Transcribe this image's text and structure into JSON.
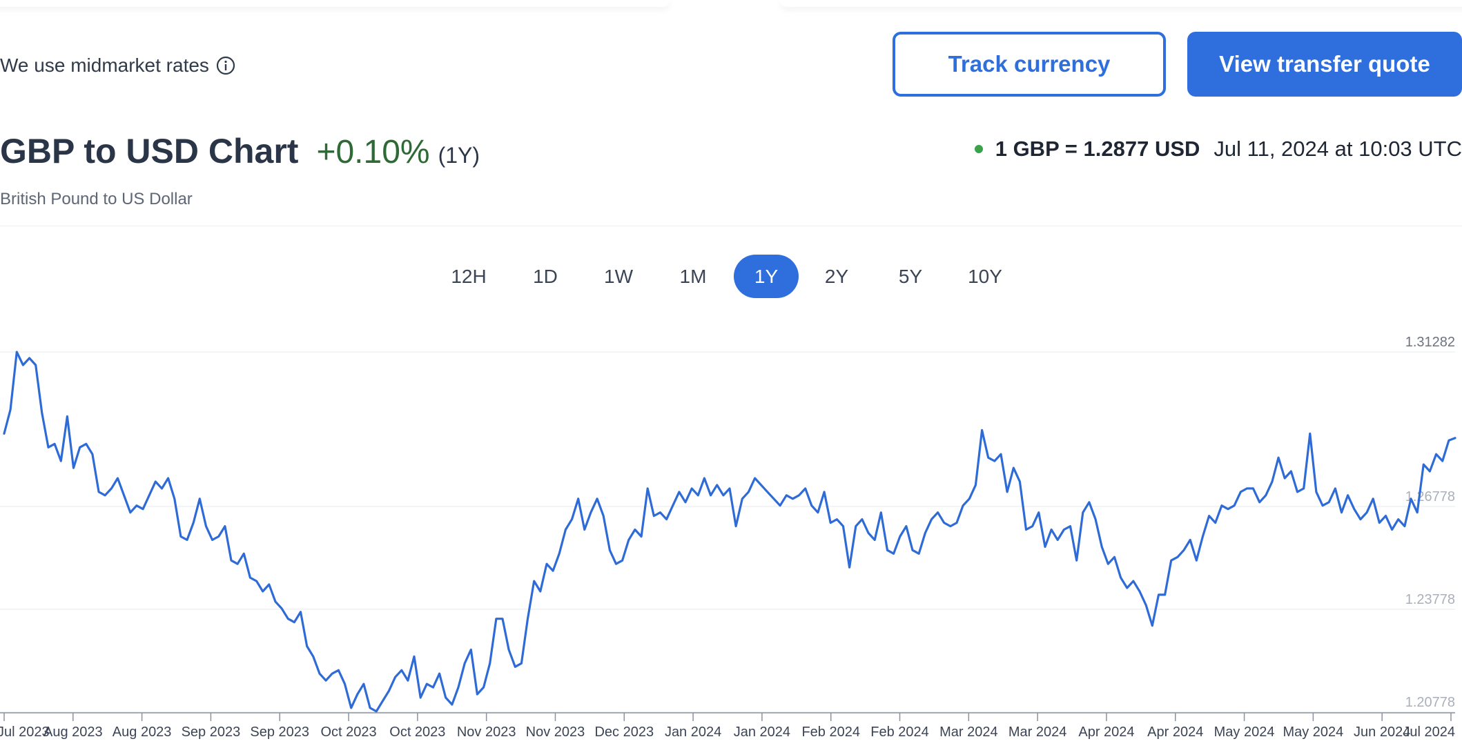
{
  "header": {
    "info_text": "We use midmarket rates",
    "info_icon": "info-icon",
    "track_label": "Track currency",
    "quote_label": "View transfer quote"
  },
  "title": {
    "main": "GBP to USD Chart",
    "change": "+0.10%",
    "period": "(1Y)",
    "subtitle": "British Pound to US Dollar"
  },
  "rate": {
    "value": "1 GBP = 1.2877 USD",
    "timestamp": "Jul 11, 2024 at 10:03 UTC"
  },
  "periods": [
    {
      "label": "12H",
      "active": false
    },
    {
      "label": "1D",
      "active": false
    },
    {
      "label": "1W",
      "active": false
    },
    {
      "label": "1M",
      "active": false
    },
    {
      "label": "1Y",
      "active": true
    },
    {
      "label": "2Y",
      "active": false
    },
    {
      "label": "5Y",
      "active": false
    },
    {
      "label": "10Y",
      "active": false
    }
  ],
  "colors": {
    "accent": "#2f6fdd",
    "line": "#2e6bd6",
    "positive": "#2e6a35",
    "live_dot": "#3aa34a"
  },
  "chart_data": {
    "type": "line",
    "x_ticks": [
      "Jul 2023",
      "Aug 2023",
      "Aug 2023",
      "Sep 2023",
      "Sep 2023",
      "Oct 2023",
      "Oct 2023",
      "Nov 2023",
      "Nov 2023",
      "Dec 2023",
      "Jan 2024",
      "Jan 2024",
      "Feb 2024",
      "Feb 2024",
      "Mar 2024",
      "Mar 2024",
      "Apr 2024",
      "Apr 2024",
      "May 2024",
      "May 2024",
      "Jun 2024",
      "Jul 2024"
    ],
    "y_ticks": [
      "1.31282",
      "1.26778",
      "1.23778",
      "1.20778"
    ],
    "ylim": [
      1.20778,
      1.31282
    ],
    "series": [
      {
        "values": [
          1.289,
          1.296,
          1.3128,
          1.309,
          1.311,
          1.309,
          1.295,
          1.285,
          1.286,
          1.281,
          1.294,
          1.279,
          1.285,
          1.286,
          1.283,
          1.272,
          1.271,
          1.273,
          1.276,
          1.271,
          1.266,
          1.268,
          1.267,
          1.271,
          1.275,
          1.273,
          1.276,
          1.27,
          1.259,
          1.258,
          1.263,
          1.27,
          1.262,
          1.258,
          1.259,
          1.262,
          1.252,
          1.251,
          1.254,
          1.247,
          1.246,
          1.243,
          1.245,
          1.24,
          1.238,
          1.235,
          1.234,
          1.237,
          1.227,
          1.224,
          1.219,
          1.217,
          1.219,
          1.22,
          1.216,
          1.209,
          1.213,
          1.216,
          1.209,
          1.208,
          1.211,
          1.214,
          1.218,
          1.22,
          1.217,
          1.224,
          1.212,
          1.216,
          1.215,
          1.219,
          1.212,
          1.21,
          1.215,
          1.222,
          1.226,
          1.213,
          1.215,
          1.222,
          1.235,
          1.235,
          1.226,
          1.221,
          1.222,
          1.235,
          1.246,
          1.243,
          1.251,
          1.249,
          1.254,
          1.261,
          1.264,
          1.27,
          1.261,
          1.266,
          1.27,
          1.265,
          1.255,
          1.251,
          1.252,
          1.258,
          1.261,
          1.259,
          1.273,
          1.265,
          1.266,
          1.264,
          1.268,
          1.272,
          1.269,
          1.273,
          1.271,
          1.276,
          1.271,
          1.274,
          1.271,
          1.273,
          1.262,
          1.27,
          1.272,
          1.276,
          1.274,
          1.272,
          1.27,
          1.268,
          1.271,
          1.27,
          1.271,
          1.273,
          1.268,
          1.266,
          1.272,
          1.263,
          1.264,
          1.262,
          1.25,
          1.262,
          1.264,
          1.26,
          1.258,
          1.266,
          1.255,
          1.254,
          1.259,
          1.262,
          1.255,
          1.254,
          1.26,
          1.264,
          1.266,
          1.263,
          1.262,
          1.263,
          1.268,
          1.27,
          1.274,
          1.29,
          1.282,
          1.281,
          1.283,
          1.272,
          1.279,
          1.275,
          1.261,
          1.262,
          1.266,
          1.256,
          1.261,
          1.258,
          1.261,
          1.262,
          1.252,
          1.266,
          1.269,
          1.264,
          1.256,
          1.251,
          1.253,
          1.247,
          1.244,
          1.246,
          1.243,
          1.239,
          1.233,
          1.242,
          1.242,
          1.252,
          1.253,
          1.255,
          1.258,
          1.252,
          1.259,
          1.265,
          1.263,
          1.268,
          1.267,
          1.268,
          1.272,
          1.273,
          1.273,
          1.269,
          1.271,
          1.275,
          1.282,
          1.276,
          1.278,
          1.272,
          1.273,
          1.289,
          1.272,
          1.268,
          1.269,
          1.273,
          1.266,
          1.271,
          1.267,
          1.264,
          1.266,
          1.27,
          1.263,
          1.265,
          1.261,
          1.264,
          1.262,
          1.27,
          1.266,
          1.28,
          1.278,
          1.283,
          1.281,
          1.287,
          1.2877
        ]
      }
    ]
  }
}
